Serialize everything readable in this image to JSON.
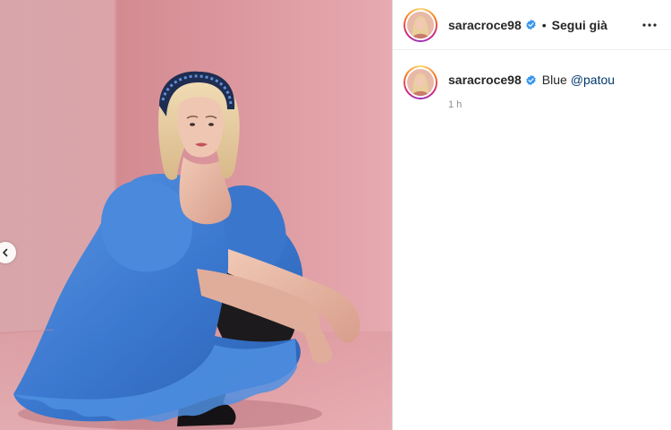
{
  "post": {
    "author": {
      "username": "saracroce98",
      "verified": true,
      "avatar": "profile-photo"
    },
    "header": {
      "separator": "•",
      "follow_label": "Segui già",
      "more_icon": "more-horizontal-icon"
    },
    "caption": {
      "text": "Blue",
      "mention": "@patou"
    },
    "timestamp": "1 h",
    "media": {
      "description_icon": "photo",
      "carousel_prev_icon": "chevron-left-icon"
    }
  },
  "colors": {
    "verified_blue": "#3897f0",
    "mention_blue": "#00376b",
    "background_pink": "#de9ca2",
    "dress_blue": "#3d7bd1"
  }
}
